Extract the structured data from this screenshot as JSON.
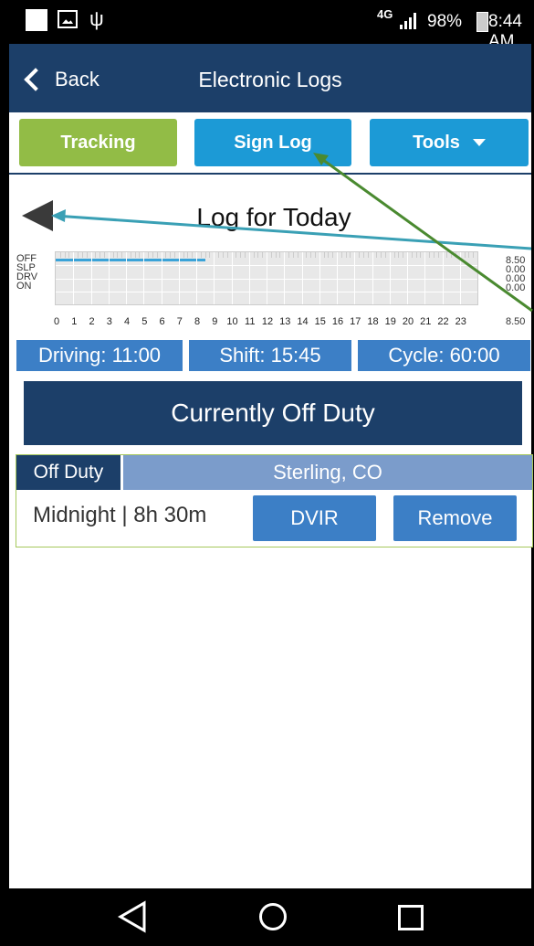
{
  "status_bar": {
    "network": "4G",
    "battery": "98%",
    "time": "8:44 AM",
    "icons": [
      "square-icon",
      "image-icon",
      "usb-icon",
      "signal-icon",
      "battery-icon"
    ]
  },
  "nav": {
    "back_label": "Back",
    "title": "Electronic Logs"
  },
  "toolbar": {
    "tracking_label": "Tracking",
    "sign_log_label": "Sign Log",
    "tools_label": "Tools",
    "colors": {
      "tracking": "#92bc46",
      "primary": "#1c9ad6",
      "header": "#1c3f69"
    }
  },
  "log": {
    "title": "Log for Today",
    "rows": [
      "OFF",
      "SLP",
      "DRV",
      "ON"
    ],
    "row_totals": [
      "8.50",
      "0.00",
      "0.00",
      "0.00"
    ],
    "total": "8.50",
    "hours": [
      "0",
      "1",
      "2",
      "3",
      "4",
      "5",
      "6",
      "7",
      "8",
      "9",
      "10",
      "11",
      "12",
      "13",
      "14",
      "15",
      "16",
      "17",
      "18",
      "19",
      "20",
      "21",
      "22",
      "23"
    ],
    "off_duty_until_hour": 8.5
  },
  "stats": {
    "driving": "Driving: 11:00",
    "shift": "Shift: 15:45",
    "cycle": "Cycle: 60:00"
  },
  "current_status": "Currently Off Duty",
  "event": {
    "duty": "Off Duty",
    "location": "Sterling,  CO",
    "time": "Midnight | 8h 30m",
    "dvir_label": "DVIR",
    "remove_label": "Remove"
  }
}
